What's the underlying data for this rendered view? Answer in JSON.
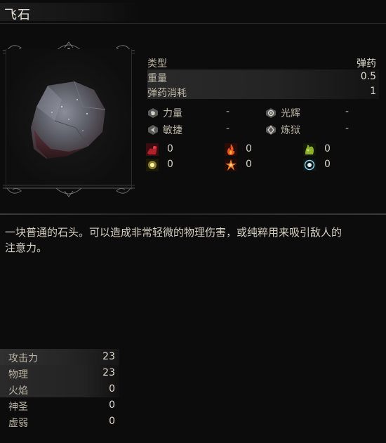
{
  "item": {
    "name": "飞石"
  },
  "stats": [
    {
      "label": "类型",
      "value": "弹药"
    },
    {
      "label": "重量",
      "value": "0.5"
    },
    {
      "label": "弹药消耗",
      "value": "1"
    }
  ],
  "requirements": [
    {
      "icon": "strength-icon",
      "label": "力量",
      "value": "-"
    },
    {
      "icon": "faith-icon",
      "label": "光辉",
      "value": "-"
    },
    {
      "icon": "dexterity-icon",
      "label": "敏捷",
      "value": "-"
    },
    {
      "icon": "pyromancy-icon",
      "label": "炼狱",
      "value": "-"
    }
  ],
  "elemental": [
    {
      "icon": "bleed-icon",
      "value": "0",
      "color": "#b0202a"
    },
    {
      "icon": "fire-icon",
      "value": "0",
      "color": "#e0561c"
    },
    {
      "icon": "poison-icon",
      "value": "0",
      "color": "#8db030"
    },
    {
      "icon": "lightning-icon",
      "value": "0",
      "color": "#e8d24a"
    },
    {
      "icon": "burst-icon",
      "value": "0",
      "color": "#f07a22"
    },
    {
      "icon": "frost-icon",
      "value": "0",
      "color": "#8fd0e0"
    }
  ],
  "description": {
    "line1": "一块普通的石头。可以造成非常轻微的物理伤害，或纯粹用来吸引敌人的",
    "line2": "注意力。"
  },
  "attack": [
    {
      "label": "攻击力",
      "value": "23"
    },
    {
      "label": "物理",
      "value": "23"
    },
    {
      "label": "火焰",
      "value": "0"
    },
    {
      "label": "神圣",
      "value": "0"
    },
    {
      "label": "虚弱",
      "value": "0"
    }
  ]
}
